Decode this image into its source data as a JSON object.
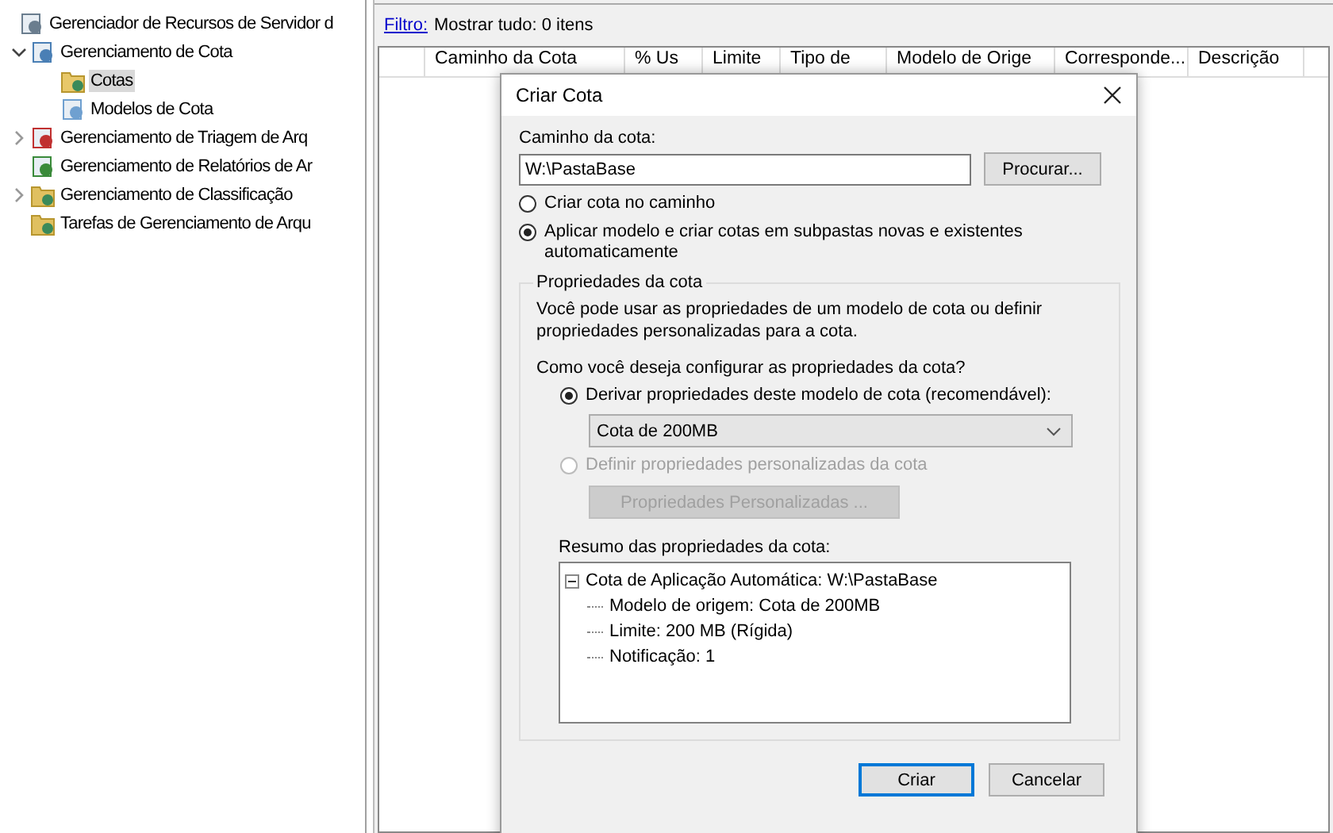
{
  "tree": [
    {
      "label": "Gerenciador de Recursos de Servidor d",
      "kind": "server",
      "selected": false,
      "children": [
        {
          "label": "Gerenciamento de Cota",
          "kind": "quota",
          "selected": false,
          "expanded": true,
          "children": [
            {
              "label": "Cotas",
              "kind": "folder",
              "selected": true
            },
            {
              "label": "Modelos de Cota",
              "kind": "model",
              "selected": false
            }
          ]
        },
        {
          "label": "Gerenciamento de Triagem de Arq",
          "kind": "screen",
          "selected": false,
          "expanded": false
        },
        {
          "label": "Gerenciamento de Relatórios de Ar",
          "kind": "report",
          "selected": false
        },
        {
          "label": "Gerenciamento de Classificação",
          "kind": "classify",
          "selected": false,
          "expanded": false
        },
        {
          "label": "Tarefas de Gerenciamento de Arqu",
          "kind": "task",
          "selected": false
        }
      ]
    }
  ],
  "filter": {
    "link": "Filtro:",
    "text": "Mostrar tudo: 0 itens"
  },
  "columns": [
    "",
    "Caminho da Cota",
    "% Us",
    "Limite",
    "Tipo de",
    "Modelo de Orige",
    "Corresponde...",
    "Descrição"
  ],
  "dialog": {
    "title": "Criar Cota",
    "path_label": "Caminho da cota:",
    "path_value": "W:\\PastaBase",
    "browse": "Procurar...",
    "modes": [
      {
        "label": "Criar cota no caminho",
        "selected": false
      },
      {
        "label": "Aplicar modelo e criar cotas em subpastas novas e existentes automaticamente",
        "selected": true
      }
    ],
    "group_title": "Propriedades da cota",
    "description": "Você pode usar as propriedades de um modelo de cota ou definir propriedades personalizadas para a cota.",
    "question": "Como você deseja configurar as propriedades da cota?",
    "derive": {
      "label": "Derivar propriedades deste modelo de cota (recomendável):",
      "selected": true,
      "disabled": false
    },
    "template": "Cota de 200MB",
    "custom": {
      "label": "Definir propriedades personalizadas da cota",
      "selected": false,
      "disabled": true
    },
    "custom_button": {
      "label": "Propriedades Personalizadas ...",
      "disabled": true
    },
    "summary_label": "Resumo das propriedades da cota:",
    "summary": {
      "label": "Cota de Aplicação Automática: W:\\PastaBase",
      "expanded": true,
      "children": [
        "Modelo de origem: Cota de 200MB",
        "Limite: 200 MB (Rígida)",
        "Notificação: 1"
      ]
    },
    "buttons": [
      {
        "label": "Criar",
        "default": true
      },
      {
        "label": "Cancelar",
        "default": false
      }
    ]
  }
}
